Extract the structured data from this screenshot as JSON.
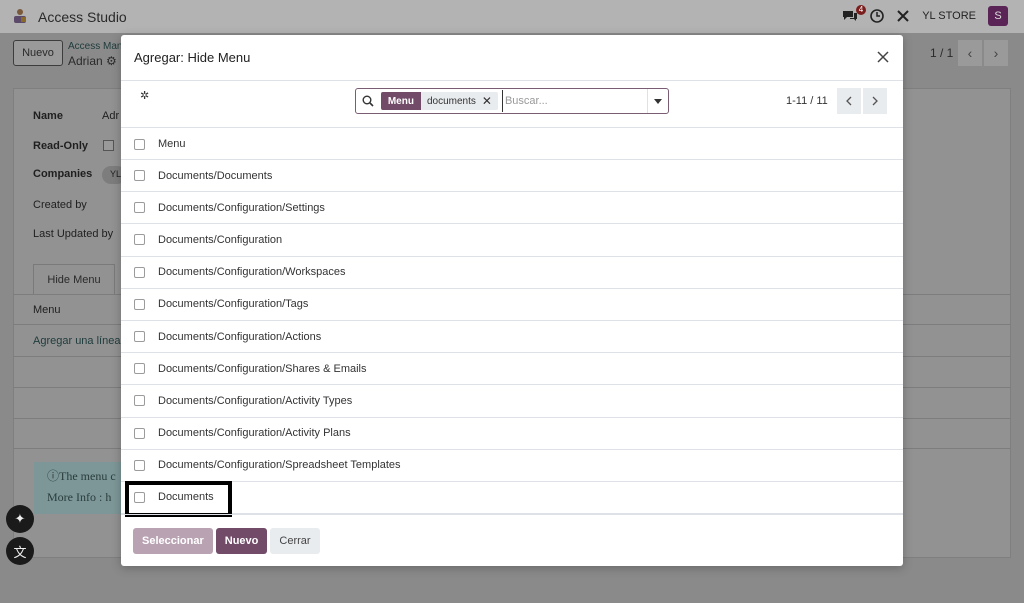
{
  "app": {
    "name": "Access Studio"
  },
  "topbar": {
    "chat_badge": "4",
    "company": "YL STORE",
    "avatar_letter": "S"
  },
  "background": {
    "new_button": "Nuevo",
    "breadcrumb_parent": "Access Man",
    "breadcrumb_current": "Adrian",
    "pager": "1 / 1",
    "fields": {
      "name": "Name",
      "name_value": "Adr",
      "read_only": "Read-Only",
      "companies": "Companies",
      "companies_tag": "YL",
      "created_by": "Created by",
      "last_updated_by": "Last Updated by"
    },
    "tab": "Hide Menu",
    "menu_header": "Menu",
    "add_line": "Agregar una línea",
    "note_line1": "The menu c",
    "note_line2": "More Info : h"
  },
  "modal": {
    "title": "Agregar: Hide Menu",
    "search": {
      "facet_label": "Menu",
      "facet_value": "documents",
      "placeholder": "Buscar..."
    },
    "pager": "1-11 / 11",
    "list": {
      "header": "Menu",
      "rows": [
        "Documents/Documents",
        "Documents/Configuration/Settings",
        "Documents/Configuration",
        "Documents/Configuration/Workspaces",
        "Documents/Configuration/Tags",
        "Documents/Configuration/Actions",
        "Documents/Configuration/Shares & Emails",
        "Documents/Configuration/Activity Types",
        "Documents/Configuration/Activity Plans",
        "Documents/Configuration/Spreadsheet Templates",
        "Documents"
      ]
    },
    "footer": {
      "select": "Seleccionar",
      "new": "Nuevo",
      "close": "Cerrar"
    }
  },
  "colors": {
    "brand": "#714b67",
    "brand_light": "#b9a3b3"
  }
}
